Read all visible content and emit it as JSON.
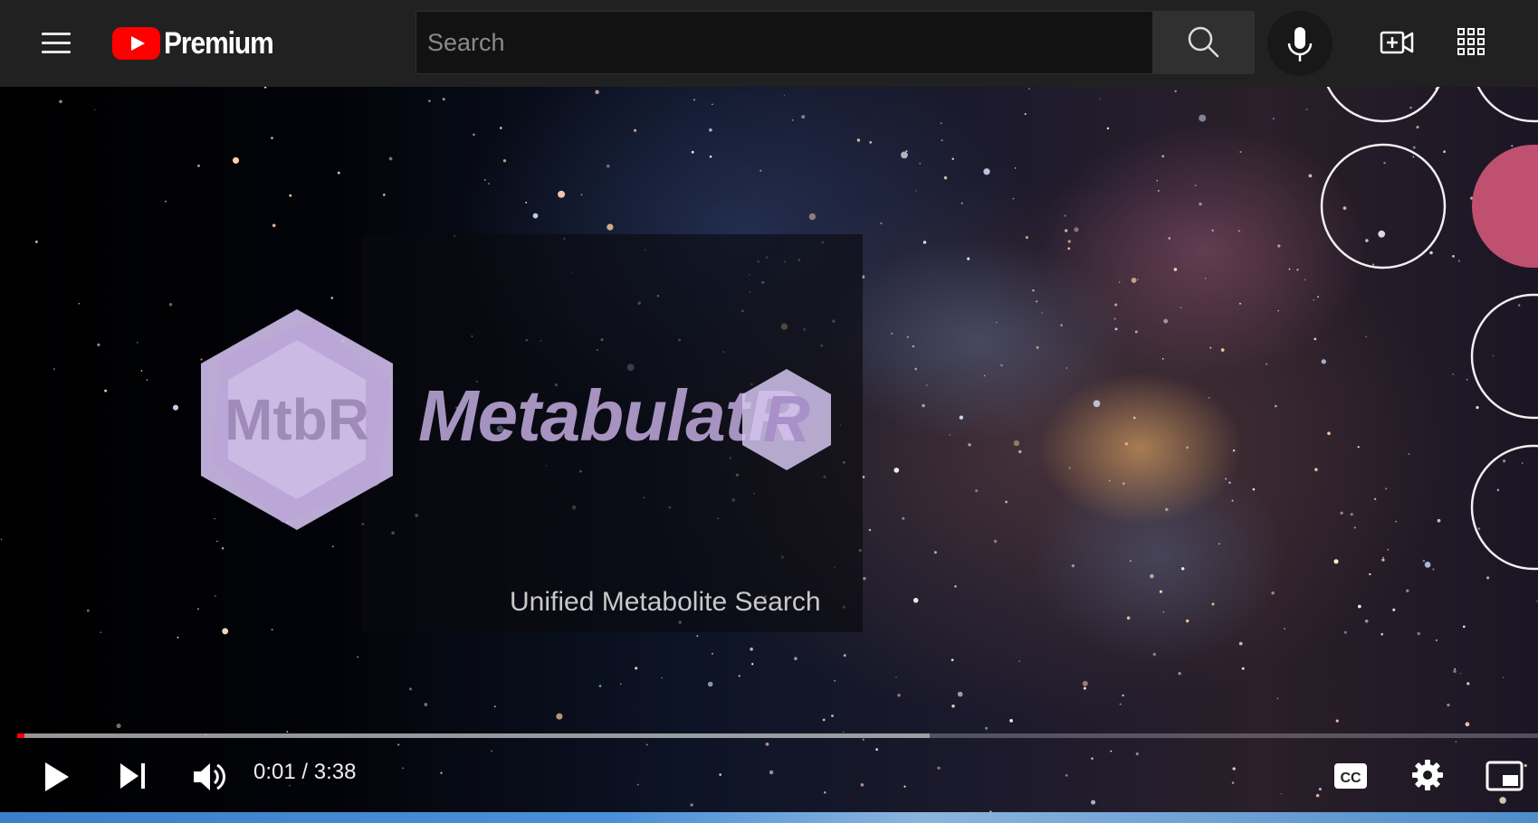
{
  "header": {
    "brand": "Premium",
    "search": {
      "placeholder": "Search",
      "value": ""
    },
    "icons": [
      "menu-icon",
      "youtube-logo-icon",
      "search-icon",
      "microphone-icon",
      "create-video-icon",
      "apps-grid-icon"
    ]
  },
  "video": {
    "card_brand": "MetabulatR",
    "card_badge": "MtbR",
    "card_small_badge": "R",
    "subtitle": "Unified Metabolite Search",
    "progress": {
      "played_fraction": 0.001,
      "buffered_fraction": 0.6
    }
  },
  "player": {
    "time_display": "0:01 / 3:38",
    "icons": [
      "play-icon",
      "next-icon",
      "volume-icon",
      "captions-icon",
      "settings-icon",
      "miniplayer-icon"
    ]
  },
  "colors": {
    "header_bg": "#212121",
    "accent_red": "#ff0000",
    "brand_purple": "#b7a2d3",
    "annotation_pink": "#c05070"
  }
}
